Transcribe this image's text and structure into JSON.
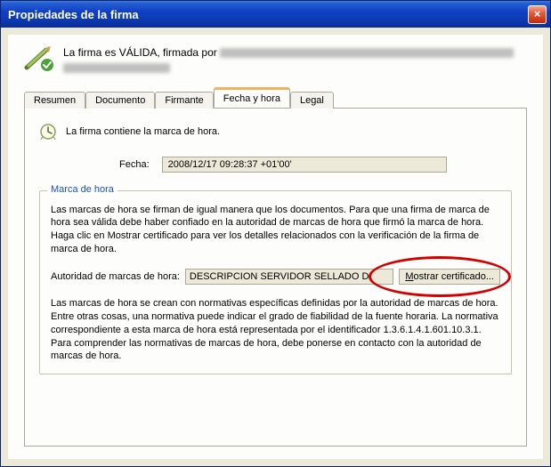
{
  "window": {
    "title": "Propiedades de la firma"
  },
  "summary": {
    "prefix": "La firma es VÁLIDA, firmada por "
  },
  "tabs": {
    "resumen": "Resumen",
    "documento": "Documento",
    "firmante": "Firmante",
    "fecha": "Fecha y hora",
    "legal": "Legal"
  },
  "panel": {
    "intro": "La firma contiene la marca de hora.",
    "date_label": "Fecha:",
    "date_value": "2008/12/17 09:28:37 +01'00'",
    "group_title": "Marca de hora",
    "para1": "Las marcas de hora se firman de igual manera que los documentos. Para que una firma de marca de hora sea válida debe haber confiado en la autoridad de marcas de hora que firmó la marca de hora. Haga clic en Mostrar certificado para ver los detalles relacionados con la verificación de la firma de marca de hora.",
    "auth_label": "Autoridad de marcas de hora:",
    "auth_value": "DESCRIPCION SERVIDOR SELLADO D",
    "show_cert": "Mostrar certificado...",
    "para2": "Las marcas de hora se crean con normativas específicas definidas por la autoridad de marcas de hora. Entre otras cosas, una normativa puede indicar el grado de fiabilidad de la fuente horaria. La normativa correspondiente a esta marca de hora está representada por el identificador 1.3.6.1.4.1.601.10.3.1. Para comprender las normativas de marcas de hora, debe ponerse en contacto con la autoridad de marcas de hora."
  }
}
